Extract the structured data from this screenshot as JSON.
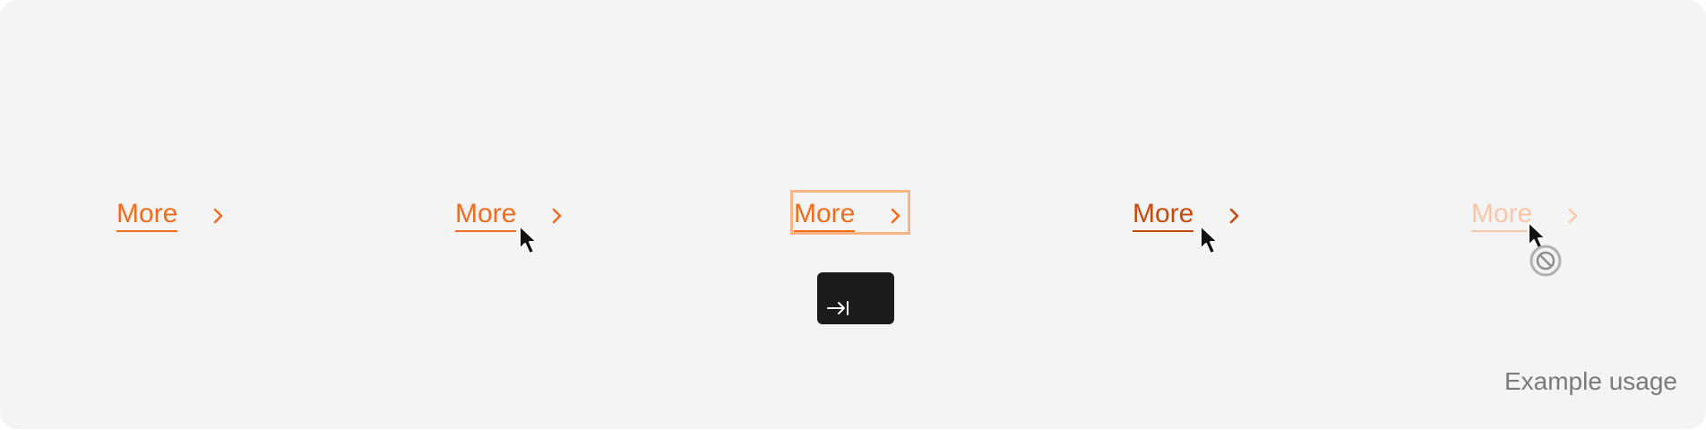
{
  "links": [
    {
      "state": "default",
      "label": "More",
      "icon": "chevron-right-icon"
    },
    {
      "state": "hover",
      "label": "More",
      "icon": "chevron-right-icon"
    },
    {
      "state": "focus",
      "label": "More",
      "icon": "chevron-right-icon"
    },
    {
      "state": "pressed",
      "label": "More",
      "icon": "chevron-right-icon"
    },
    {
      "state": "disabled",
      "label": "More",
      "icon": "chevron-right-icon"
    }
  ],
  "tab_key": {
    "icon": "tab-key-icon"
  },
  "cursors": {
    "hover": "pointer-cursor-icon",
    "pressed": "pointer-cursor-icon",
    "disabled": "not-allowed-cursor-icon"
  },
  "footer": {
    "note": "Example usage"
  },
  "colors": {
    "background": "#f4f4f4",
    "link": "#f36b1c",
    "link_pressed": "#c84a0a",
    "link_disabled": "#f9c6a8",
    "focus_ring": "#f8b487",
    "key_background": "#1c1b1b",
    "note": "#7a7a7a"
  }
}
